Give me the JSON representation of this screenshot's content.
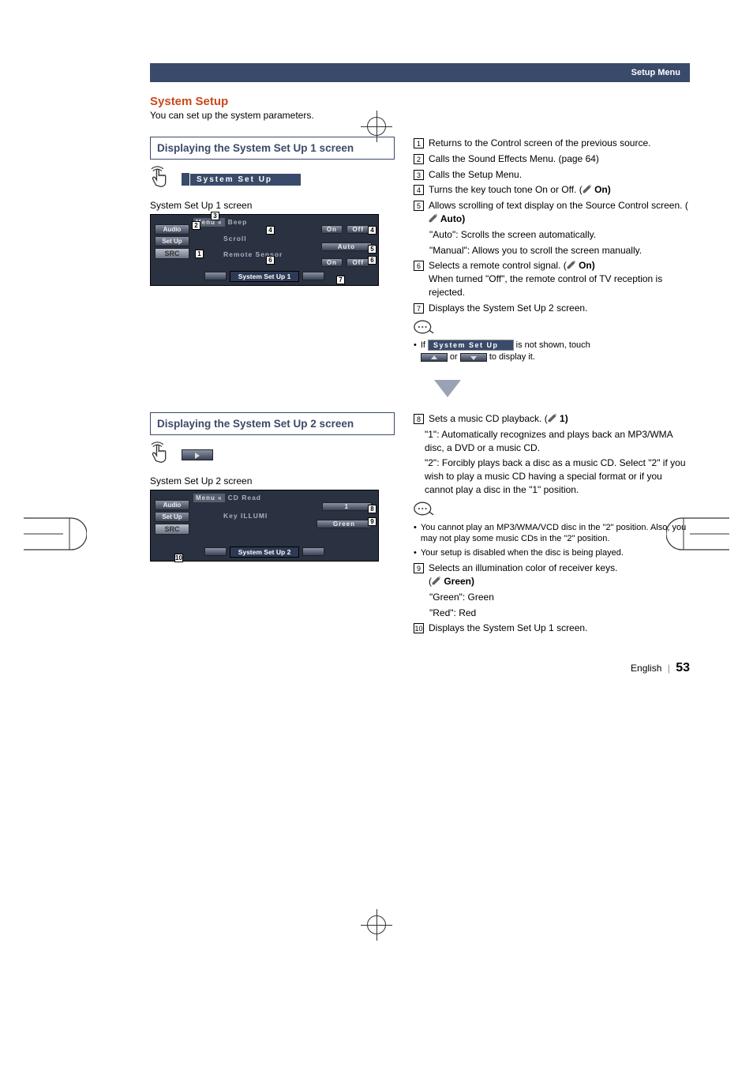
{
  "header": {
    "breadcrumb": "Setup Menu"
  },
  "section": {
    "title": "System Setup",
    "intro": "You can set up the system parameters."
  },
  "panel1": {
    "heading": "Displaying the System Set Up 1 screen",
    "tab_label": "System Set Up",
    "caption": "System Set Up 1 screen",
    "screen": {
      "side_audio": "Audio",
      "side_setup": "Set Up",
      "side_src": "SRC",
      "menu_btn": "Menu",
      "item_beep": "Beep",
      "item_scroll": "Scroll",
      "item_scroll_val": "Auto",
      "item_remote": "Remote Sensor",
      "on": "On",
      "off": "Off",
      "footer_label": "System Set Up 1"
    }
  },
  "panel2": {
    "heading": "Displaying the System Set Up 2 screen",
    "caption": "System Set Up 2 screen",
    "screen": {
      "side_audio": "Audio",
      "side_setup": "Set Up",
      "side_src": "SRC",
      "menu_btn": "Menu",
      "item_cdread": "CD Read",
      "item_cdread_val": "1",
      "item_keyillumi": "Key ILLUMI",
      "item_keyillumi_val": "Green",
      "footer_label": "System Set Up 2"
    }
  },
  "desc1": {
    "i1": "Returns to the Control screen of the previous source.",
    "i2": "Calls the Sound Effects Menu. (page 64)",
    "i3": "Calls the Setup Menu.",
    "i4_a": "Turns the key touch tone On or Off. (",
    "i4_b": " On)",
    "i5_a": "Allows scrolling of text display on the Source Control screen. (",
    "i5_b": " Auto)",
    "i5_auto": "\"Auto\":    Scrolls the screen automatically.",
    "i5_manual": "\"Manual\": Allows you to scroll the screen manually.",
    "i6_a": "Selects a remote control signal. (",
    "i6_b": " On)",
    "i6_c": "When turned \"Off\", the remote control of TV reception is rejected.",
    "i7": "Displays the System Set Up 2 screen.",
    "note_if": "If ",
    "note_tab": "System Set Up",
    "note_mid": " is not shown, touch ",
    "note_or": " or ",
    "note_end": " to display it."
  },
  "desc2": {
    "i8_a": "Sets a music CD playback. (",
    "i8_b": " 1)",
    "i8_1": "\"1\":  Automatically recognizes and plays back an MP3/WMA disc, a DVD or a music CD.",
    "i8_2": "\"2\":  Forcibly plays back a disc as a music CD.  Select \"2\" if you wish to play a music CD having a special format or if you cannot play a disc in the \"1\" position.",
    "note_a": "You cannot play an MP3/WMA/VCD disc in the \"2\" position. Also, you may not play some music CDs in the \"2\" position.",
    "note_b": "Your setup is disabled when the disc is being played.",
    "i9_a": "Selects an illumination color of receiver keys.",
    "i9_b": "(",
    "i9_c": " Green)",
    "i9_green": "\"Green\":   Green",
    "i9_red": "\"Red\":      Red",
    "i10": "Displays the System Set Up 1 screen."
  },
  "footer": {
    "lang": "English",
    "page": "53"
  }
}
